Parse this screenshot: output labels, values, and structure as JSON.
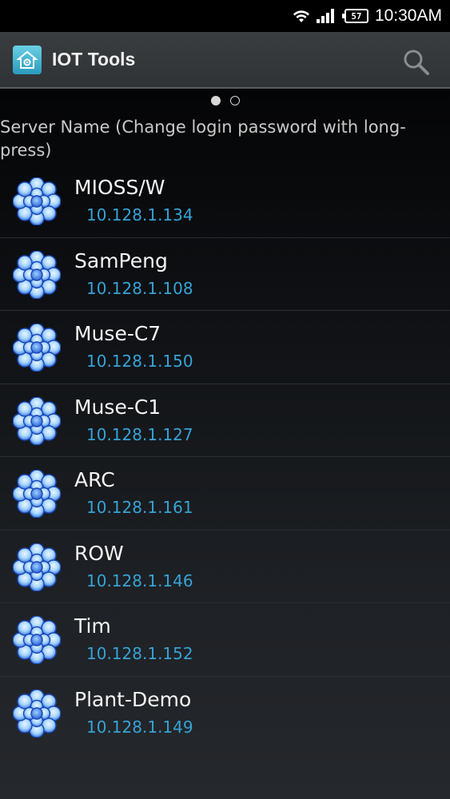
{
  "status_bar": {
    "battery_level": "57",
    "time": "10:30AM"
  },
  "action_bar": {
    "title": "IOT Tools"
  },
  "pager": {
    "pages": 2,
    "current": 0
  },
  "list_header": "Server Name (Change login password with long-press)",
  "servers": [
    {
      "name": "MIOSS/W",
      "ip": "10.128.1.134"
    },
    {
      "name": "SamPeng",
      "ip": "10.128.1.108"
    },
    {
      "name": "Muse-C7",
      "ip": "10.128.1.150"
    },
    {
      "name": "Muse-C1",
      "ip": "10.128.1.127"
    },
    {
      "name": "ARC",
      "ip": "10.128.1.161"
    },
    {
      "name": "ROW",
      "ip": "10.128.1.146"
    },
    {
      "name": "Tim",
      "ip": "10.128.1.152"
    },
    {
      "name": "Plant-Demo",
      "ip": "10.128.1.149"
    }
  ],
  "icons": {
    "wifi": "wifi-icon",
    "signal": "signal-icon",
    "battery": "battery-icon",
    "app": "home-gear-icon",
    "search": "search-icon",
    "server": "flower-cluster-icon"
  },
  "colors": {
    "accent": "#36a3d6",
    "action_bar": "#333639"
  }
}
